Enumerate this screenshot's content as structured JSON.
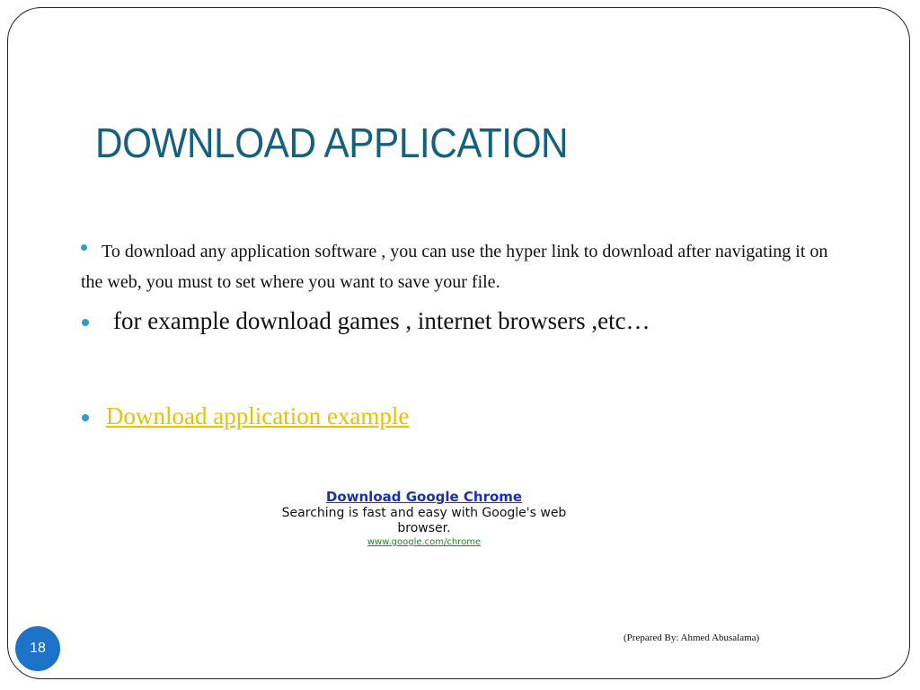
{
  "slide": {
    "title": "DOWNLOAD APPLICATION",
    "bullets": [
      "To download any application software , you can use the hyper link to download after navigating it on  the web,  you must to set where you want to save your file.",
      " for example download games , internet browsers ,etc…",
      "Download application example"
    ],
    "ad": {
      "title": "Download Google Chrome",
      "description": "Searching is fast and easy with Google's web browser.",
      "url": "www.google.com/chrome"
    },
    "footer": "(Prepared By: Ahmed Abusalama)",
    "page_number": "18"
  },
  "colors": {
    "title": "#16607f",
    "bullet": "#2f9bd0",
    "link": "#e6c200",
    "page_badge": "#1c73c7"
  }
}
